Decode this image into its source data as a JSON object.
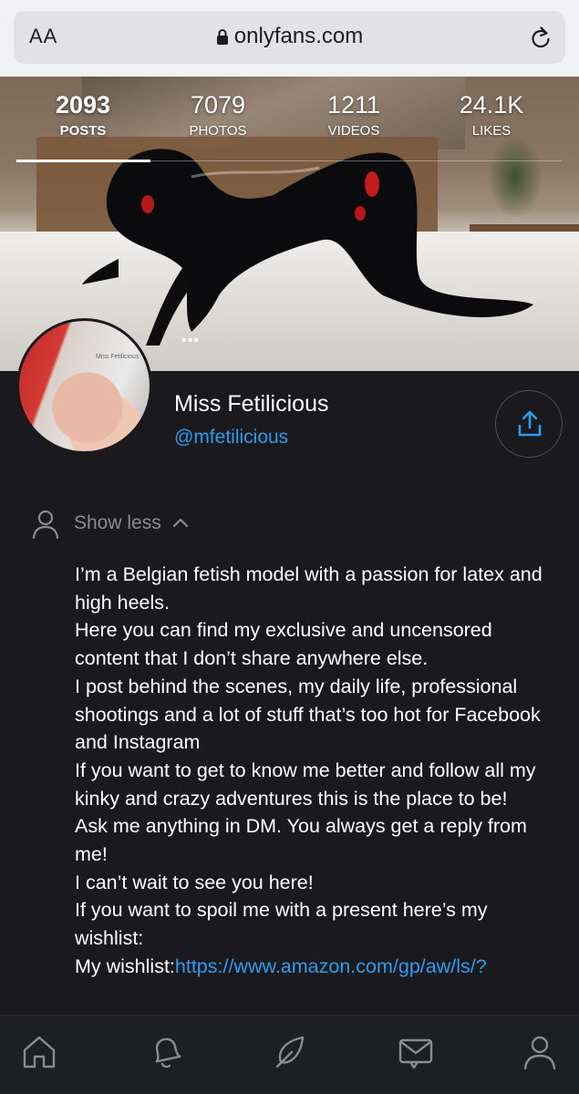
{
  "browser": {
    "aa_label": "AA",
    "url": "onlyfans.com"
  },
  "cover": {
    "stats": [
      {
        "value": "2093",
        "label": "POSTS",
        "active": true
      },
      {
        "value": "7079",
        "label": "PHOTOS",
        "active": false
      },
      {
        "value": "1211",
        "label": "VIDEOS",
        "active": false
      },
      {
        "value": "24.1K",
        "label": "LIKES",
        "active": false
      }
    ],
    "more_dots": "•••"
  },
  "profile": {
    "avatar_watermark": "Miss Fetilicious",
    "display_name": "Miss Fetilicious",
    "username": "@mfetilicious",
    "show_less_label": "Show less",
    "bio_lines": [
      "I’m a Belgian fetish model with a passion for latex and high heels.",
      "Here you can find my exclusive and uncensored content that I don’t share anywhere else.",
      "I post behind the scenes, my daily life, professional shootings and a lot of stuff that’s too hot for Facebook and Instagram",
      "If you want to get to know me better and follow all my kinky and crazy adventures this is the place to be!",
      "Ask me anything in DM. You always get a reply from me!",
      "I can’t wait to see you here!",
      "If you want to spoil me with a present here’s my wishlist:"
    ],
    "wishlist_label": "My wishlist:",
    "wishlist_link": "https://www.amazon.com/gp/aw/ls/?"
  },
  "nav": {
    "items": [
      "home-icon",
      "bell-icon",
      "feather-icon",
      "message-icon",
      "user-icon"
    ]
  },
  "colors": {
    "background": "#1a1a1e",
    "link": "#2d9cf0",
    "muted": "#8a8b92"
  }
}
